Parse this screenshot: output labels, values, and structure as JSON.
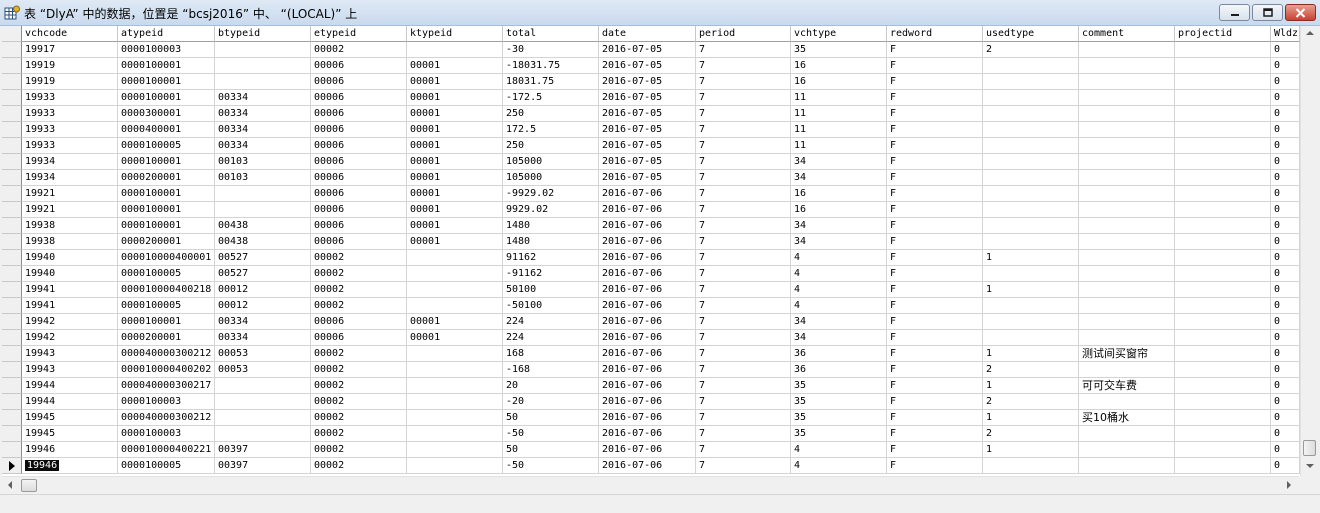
{
  "window": {
    "title": "表 “DlyA” 中的数据，位置是 “bcsj2016” 中、 “(LOCAL)” 上"
  },
  "icons": {
    "app": "table-grid-icon",
    "minimize": "minimize-icon",
    "maximize": "maximize-icon",
    "close": "close-icon"
  },
  "colors": {
    "selection": "#0a0a0a",
    "close_button": "#c7432f"
  },
  "grid": {
    "columns": [
      "vchcode",
      "atypeid",
      "btypeid",
      "etypeid",
      "ktypeid",
      "total",
      "date",
      "period",
      "vchtype",
      "redword",
      "usedtype",
      "comment",
      "projectid",
      "Wldz("
    ],
    "rows": [
      [
        "19917",
        "0000100003",
        "",
        "00002",
        "",
        "-30",
        "2016-07-05",
        "7",
        "35",
        "F",
        "2",
        "",
        "",
        "0"
      ],
      [
        "19919",
        "0000100001",
        "",
        "00006",
        "00001",
        "-18031.75",
        "2016-07-05",
        "7",
        "16",
        "F",
        "",
        "",
        "",
        "0"
      ],
      [
        "19919",
        "0000100001",
        "",
        "00006",
        "00001",
        "18031.75",
        "2016-07-05",
        "7",
        "16",
        "F",
        "",
        "",
        "",
        "0"
      ],
      [
        "19933",
        "0000100001",
        "00334",
        "00006",
        "00001",
        "-172.5",
        "2016-07-05",
        "7",
        "11",
        "F",
        "",
        "",
        "",
        "0"
      ],
      [
        "19933",
        "0000300001",
        "00334",
        "00006",
        "00001",
        "250",
        "2016-07-05",
        "7",
        "11",
        "F",
        "",
        "",
        "",
        "0"
      ],
      [
        "19933",
        "0000400001",
        "00334",
        "00006",
        "00001",
        "172.5",
        "2016-07-05",
        "7",
        "11",
        "F",
        "",
        "",
        "",
        "0"
      ],
      [
        "19933",
        "0000100005",
        "00334",
        "00006",
        "00001",
        "250",
        "2016-07-05",
        "7",
        "11",
        "F",
        "",
        "",
        "",
        "0"
      ],
      [
        "19934",
        "0000100001",
        "00103",
        "00006",
        "00001",
        "105000",
        "2016-07-05",
        "7",
        "34",
        "F",
        "",
        "",
        "",
        "0"
      ],
      [
        "19934",
        "0000200001",
        "00103",
        "00006",
        "00001",
        "105000",
        "2016-07-05",
        "7",
        "34",
        "F",
        "",
        "",
        "",
        "0"
      ],
      [
        "19921",
        "0000100001",
        "",
        "00006",
        "00001",
        "-9929.02",
        "2016-07-06",
        "7",
        "16",
        "F",
        "",
        "",
        "",
        "0"
      ],
      [
        "19921",
        "0000100001",
        "",
        "00006",
        "00001",
        "9929.02",
        "2016-07-06",
        "7",
        "16",
        "F",
        "",
        "",
        "",
        "0"
      ],
      [
        "19938",
        "0000100001",
        "00438",
        "00006",
        "00001",
        "1480",
        "2016-07-06",
        "7",
        "34",
        "F",
        "",
        "",
        "",
        "0"
      ],
      [
        "19938",
        "0000200001",
        "00438",
        "00006",
        "00001",
        "1480",
        "2016-07-06",
        "7",
        "34",
        "F",
        "",
        "",
        "",
        "0"
      ],
      [
        "19940",
        "000010000400001",
        "00527",
        "00002",
        "",
        "91162",
        "2016-07-06",
        "7",
        "4",
        "F",
        "1",
        "",
        "",
        "0"
      ],
      [
        "19940",
        "0000100005",
        "00527",
        "00002",
        "",
        "-91162",
        "2016-07-06",
        "7",
        "4",
        "F",
        "",
        "",
        "",
        "0"
      ],
      [
        "19941",
        "000010000400218",
        "00012",
        "00002",
        "",
        "50100",
        "2016-07-06",
        "7",
        "4",
        "F",
        "1",
        "",
        "",
        "0"
      ],
      [
        "19941",
        "0000100005",
        "00012",
        "00002",
        "",
        "-50100",
        "2016-07-06",
        "7",
        "4",
        "F",
        "",
        "",
        "",
        "0"
      ],
      [
        "19942",
        "0000100001",
        "00334",
        "00006",
        "00001",
        "224",
        "2016-07-06",
        "7",
        "34",
        "F",
        "",
        "",
        "",
        "0"
      ],
      [
        "19942",
        "0000200001",
        "00334",
        "00006",
        "00001",
        "224",
        "2016-07-06",
        "7",
        "34",
        "F",
        "",
        "",
        "",
        "0"
      ],
      [
        "19943",
        "000040000300212",
        "00053",
        "00002",
        "",
        "168",
        "2016-07-06",
        "7",
        "36",
        "F",
        "1",
        "测试间买窗帘",
        "",
        "0"
      ],
      [
        "19943",
        "000010000400202",
        "00053",
        "00002",
        "",
        "-168",
        "2016-07-06",
        "7",
        "36",
        "F",
        "2",
        "",
        "",
        "0"
      ],
      [
        "19944",
        "000040000300217",
        "",
        "00002",
        "",
        "20",
        "2016-07-06",
        "7",
        "35",
        "F",
        "1",
        "可可交车费",
        "",
        "0"
      ],
      [
        "19944",
        "0000100003",
        "",
        "00002",
        "",
        "-20",
        "2016-07-06",
        "7",
        "35",
        "F",
        "2",
        "",
        "",
        "0"
      ],
      [
        "19945",
        "000040000300212",
        "",
        "00002",
        "",
        "50",
        "2016-07-06",
        "7",
        "35",
        "F",
        "1",
        "买10桶水",
        "",
        "0"
      ],
      [
        "19945",
        "0000100003",
        "",
        "00002",
        "",
        "-50",
        "2016-07-06",
        "7",
        "35",
        "F",
        "2",
        "",
        "",
        "0"
      ],
      [
        "19946",
        "000010000400221",
        "00397",
        "00002",
        "",
        "50",
        "2016-07-06",
        "7",
        "4",
        "F",
        "1",
        "",
        "",
        "0"
      ],
      [
        "19946",
        "0000100005",
        "00397",
        "00002",
        "",
        "-50",
        "2016-07-06",
        "7",
        "4",
        "F",
        "",
        "",
        "",
        "0"
      ]
    ],
    "current_row": 26
  }
}
